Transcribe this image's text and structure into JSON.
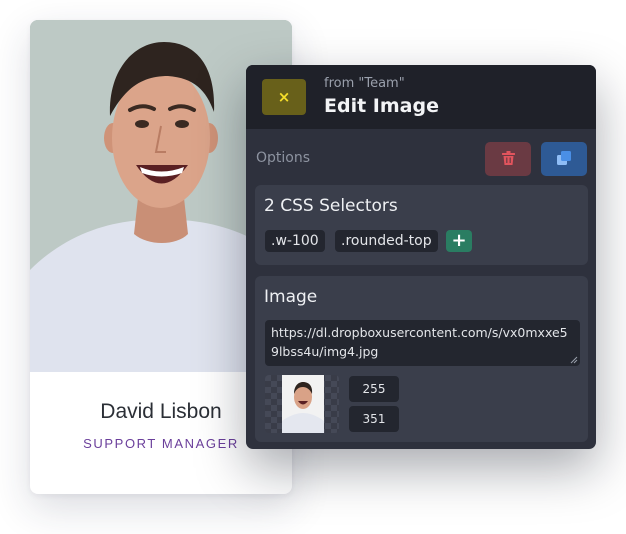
{
  "profile": {
    "name": "David Lisbon",
    "role": "SUPPORT MANAGER"
  },
  "editor": {
    "close_glyph": "×",
    "source_label": "from \"Team\"",
    "title": "Edit Image",
    "options_label": "Options",
    "icons": {
      "delete": "trash-icon",
      "duplicate": "copy-icon",
      "close": "close-icon"
    },
    "selectors": {
      "title": "2 CSS Selectors",
      "items": [
        ".w-100",
        ".rounded-top"
      ],
      "add_glyph": "+"
    },
    "image": {
      "title": "Image",
      "url": "https://dl.dropboxusercontent.com/s/vx0mxxe59lbss4u/img4.jpg",
      "width": "255",
      "height": "351"
    }
  },
  "colors": {
    "panel": "#2e313d",
    "header": "#1f2129",
    "accent_close": "#f5de2a",
    "delete_bg": "#6a3a43",
    "copy_bg": "#2e5a95",
    "add_bg": "#2a7d62",
    "role_text": "#6b3f9b"
  }
}
